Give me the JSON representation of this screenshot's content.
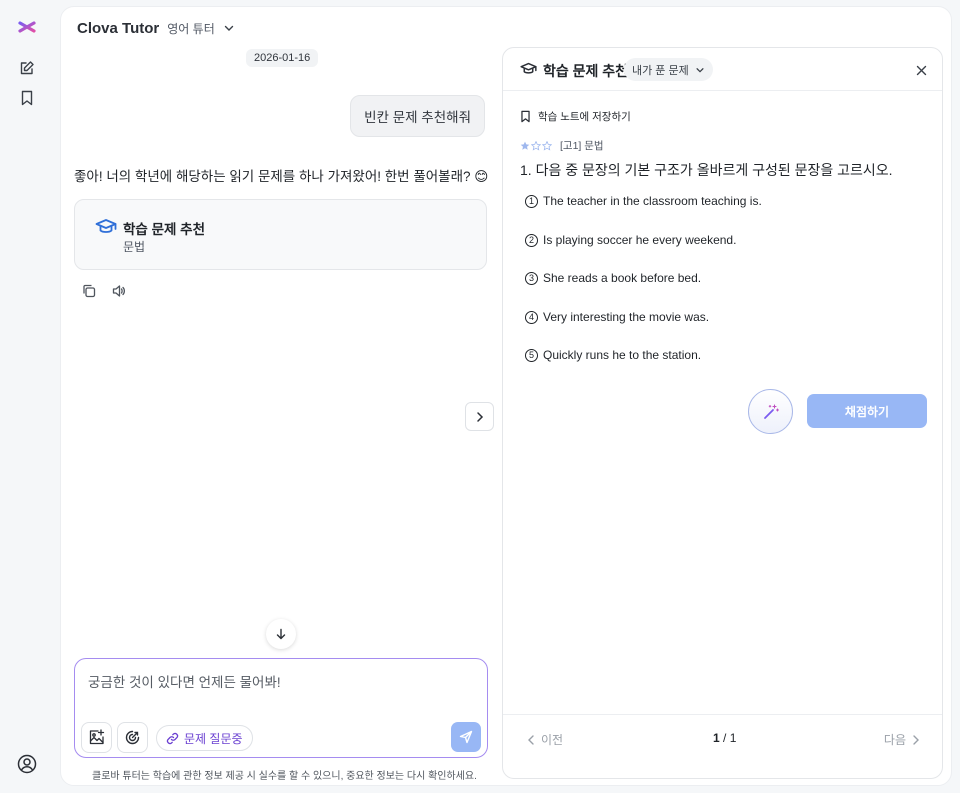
{
  "header": {
    "title": "Clova Tutor",
    "subtitle": "영어 튜터"
  },
  "chat": {
    "date": "2026-01-16",
    "user_message": "빈칸 문제 추천해줘",
    "assistant_message": "좋아! 너의 학년에 해당하는 읽기 문제를 하나 가져왔어! 한번 풀어볼래? 😊",
    "card": {
      "title": "학습 문제 추천",
      "subtitle": "문법"
    }
  },
  "composer": {
    "placeholder": "궁금한 것이 있다면 언제든 물어봐!",
    "chip_label": "문제 질문중",
    "notice": "클로바 튜터는 학습에 관한 정보 제공 시 실수를 할 수 있으니, 중요한 정보는 다시 확인하세요."
  },
  "panel": {
    "title": "학습 문제 추천",
    "filter": "내가 푼 문제",
    "save_note": "학습 노트에 저장하기",
    "difficulty_stars": 1,
    "difficulty_max": 3,
    "meta": "[고1] 문법",
    "question": "1. 다음 중 문장의 기본 구조가 올바르게 구성된 문장을 고르시오.",
    "options": [
      {
        "num": "1",
        "text": "The teacher in the classroom teaching is."
      },
      {
        "num": "2",
        "text": "Is playing soccer he every weekend."
      },
      {
        "num": "3",
        "text": "She reads a book before bed."
      },
      {
        "num": "4",
        "text": "Very interesting the movie was."
      },
      {
        "num": "5",
        "text": "Quickly runs he to the station."
      }
    ],
    "grade_button": "채점하기",
    "prev": "이전",
    "next": "다음",
    "page_current": "1",
    "page_total": "/ 1"
  },
  "colors": {
    "accent": "#98b7f5",
    "composer_border": "#a58cf0",
    "brand": "#7b5cf0"
  }
}
